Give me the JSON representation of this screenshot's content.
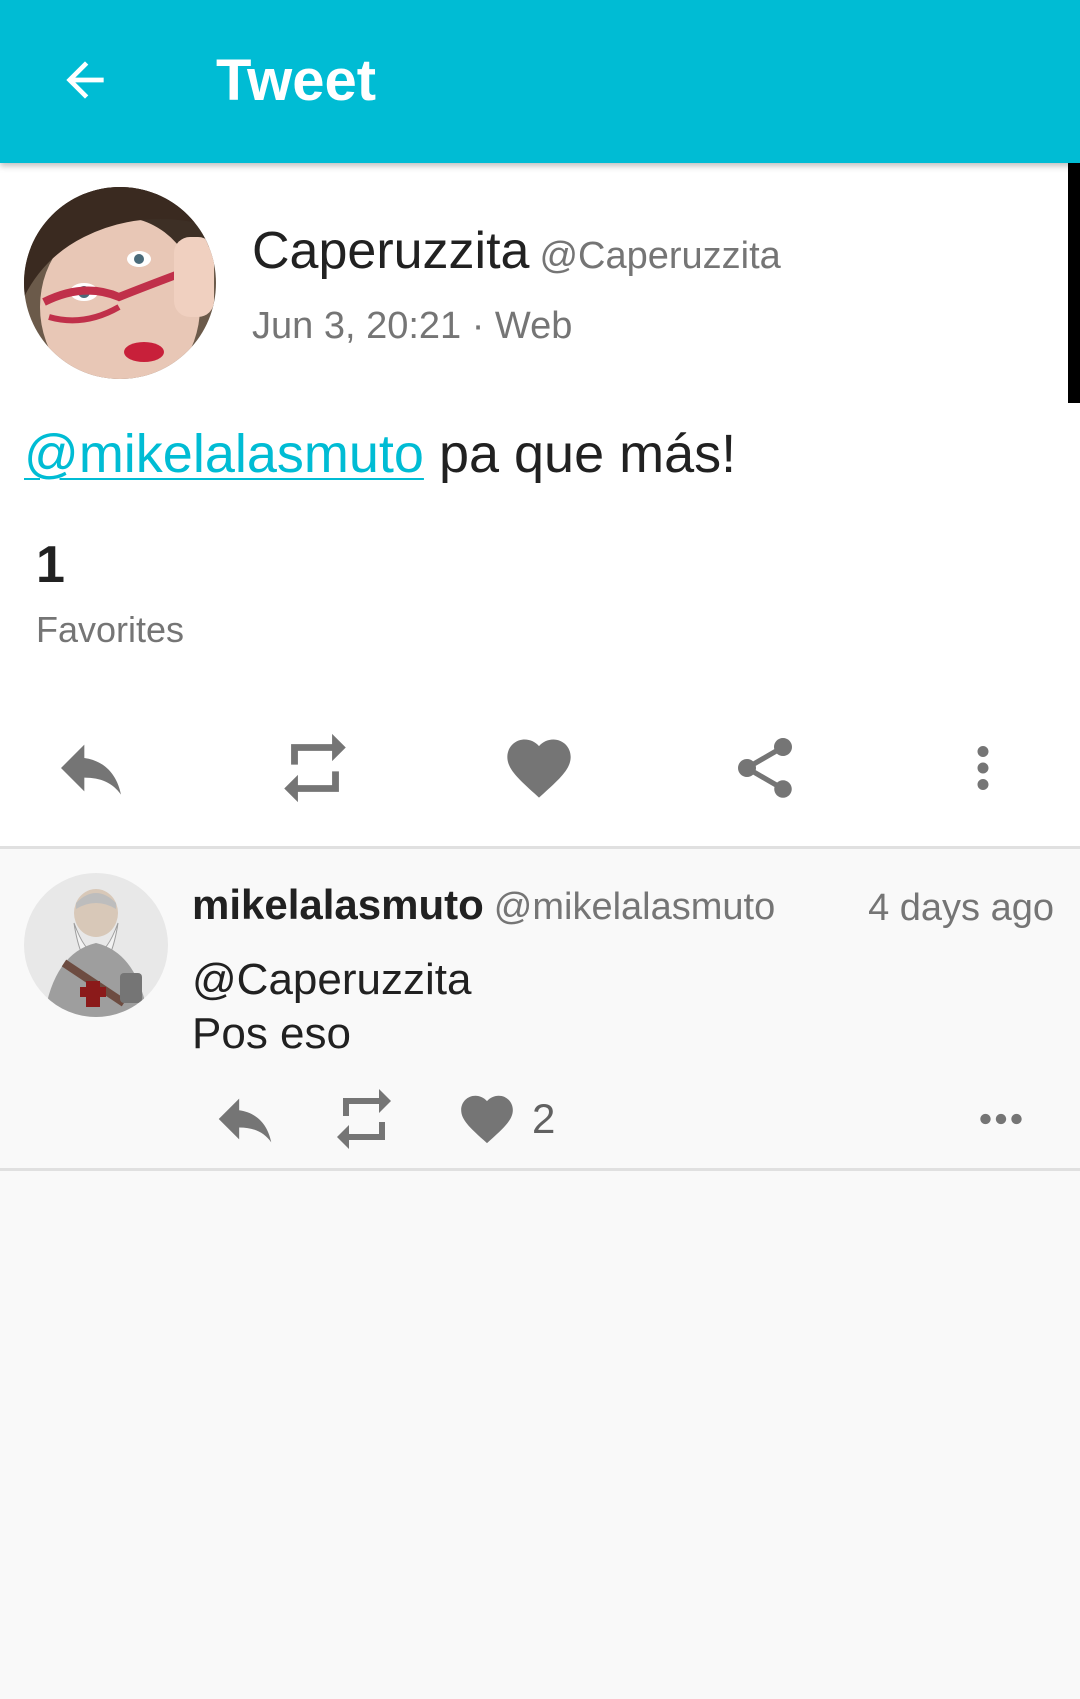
{
  "appbar": {
    "title": "Tweet",
    "color": "#00bcd4",
    "back_icon": "arrow-left-icon"
  },
  "tweet": {
    "author_name": "Caperuzzita",
    "author_handle": "@Caperuzzita",
    "meta": "Jun 3, 20:21 · Web",
    "mention": "@mikelalasmuto",
    "text_rest": " pa que más!",
    "favorites_count": "1",
    "favorites_label": "Favorites",
    "actions": [
      "reply-icon",
      "retweet-icon",
      "heart-icon",
      "share-icon",
      "more-vertical-icon"
    ]
  },
  "reply": {
    "author_name": "mikelalasmuto",
    "author_handle": "@mikelalasmuto",
    "time": "4 days ago",
    "text_line1": "@Caperuzzita",
    "text_line2": "Pos eso",
    "like_count": "2",
    "actions": [
      "reply-icon",
      "retweet-icon",
      "heart-icon",
      "more-horizontal-icon"
    ]
  },
  "colors": {
    "accent": "#00bcd4",
    "icon_gray": "#757575",
    "text_primary": "#212121",
    "text_secondary": "#757575"
  }
}
